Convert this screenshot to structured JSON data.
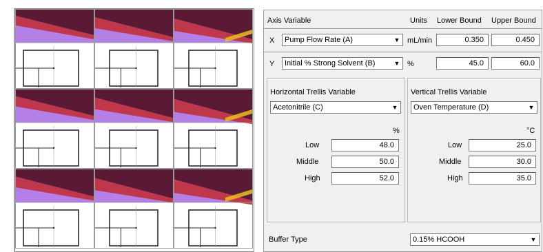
{
  "axis_table": {
    "header_axis_variable": "Axis Variable",
    "header_units": "Units",
    "header_lower": "Lower Bound",
    "header_upper": "Upper Bound",
    "x": {
      "axis": "X",
      "variable": "Pump Flow Rate (A)",
      "units": "mL/min",
      "lower": "0.350",
      "upper": "0.450"
    },
    "y": {
      "axis": "Y",
      "variable": "Initial % Strong Solvent (B)",
      "units": "%",
      "lower": "45.0",
      "upper": "60.0"
    }
  },
  "horizontal_trellis": {
    "title": "Horizontal Trellis Variable",
    "variable": "Acetonitrile (C)",
    "units": "%",
    "low_label": "Low",
    "low": "48.0",
    "middle_label": "Middle",
    "middle": "50.0",
    "high_label": "High",
    "high": "52.0"
  },
  "vertical_trellis": {
    "title": "Vertical Trellis Variable",
    "variable": "Oven Temperature (D)",
    "units": "°C",
    "low_label": "Low",
    "low": "25.0",
    "middle_label": "Middle",
    "middle": "30.0",
    "high_label": "High",
    "high": "35.0"
  },
  "buffer": {
    "label": "Buffer Type",
    "value": "0.15% HCOOH"
  },
  "icons": {
    "dropdown": "chevron-down-icon"
  },
  "colors": {
    "purple_region": "#b47fe6",
    "dark_region": "#5a1a36",
    "red_region": "#c0303a",
    "yellow_edge": "#e8c020"
  }
}
